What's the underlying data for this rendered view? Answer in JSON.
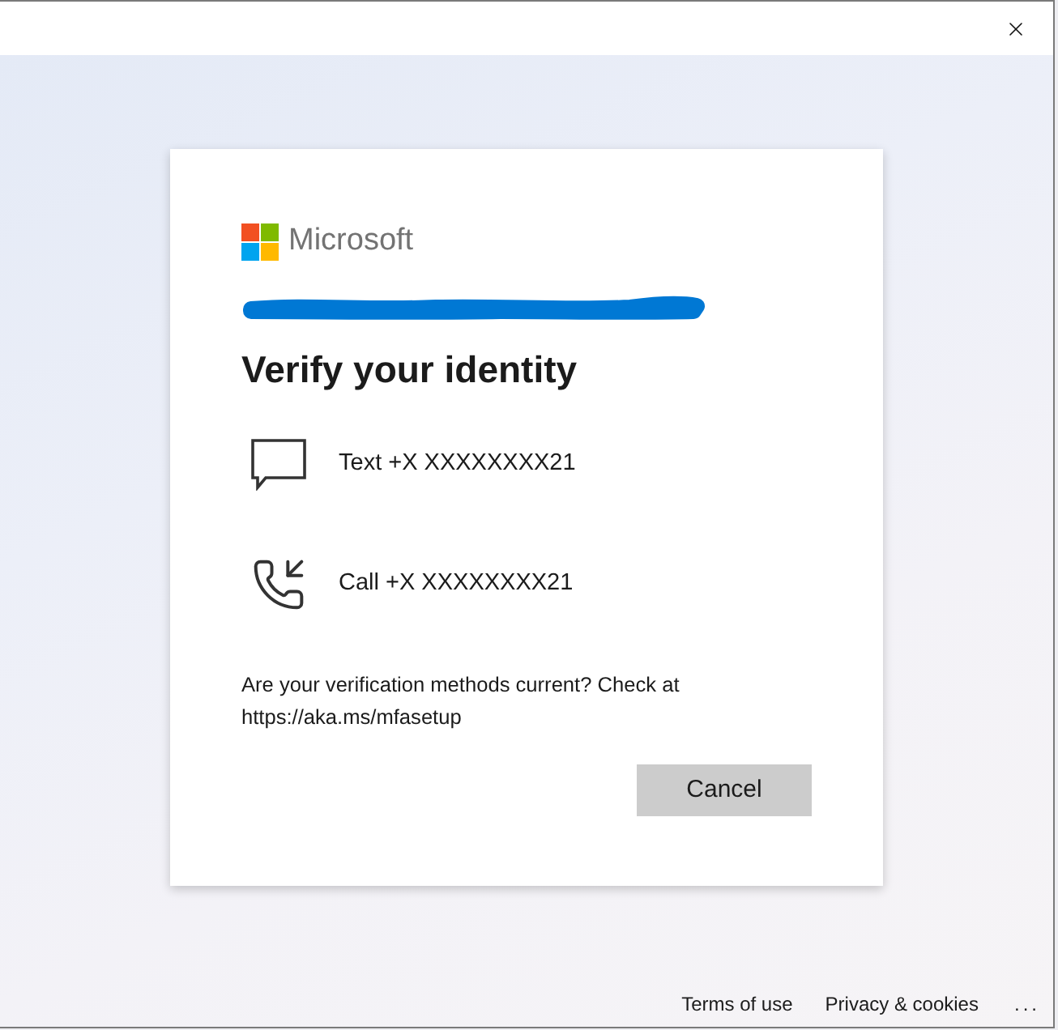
{
  "brand": {
    "name": "Microsoft"
  },
  "heading": "Verify your identity",
  "methods": [
    {
      "kind": "sms",
      "label": "Text +X XXXXXXXX21"
    },
    {
      "kind": "call",
      "label": "Call +X XXXXXXXX21"
    }
  ],
  "note": "Are your verification methods current? Check at https://aka.ms/mfasetup",
  "buttons": [
    "Cancel"
  ],
  "footer": {
    "links": [
      "Terms of use",
      "Privacy & cookies"
    ],
    "more": "..."
  }
}
